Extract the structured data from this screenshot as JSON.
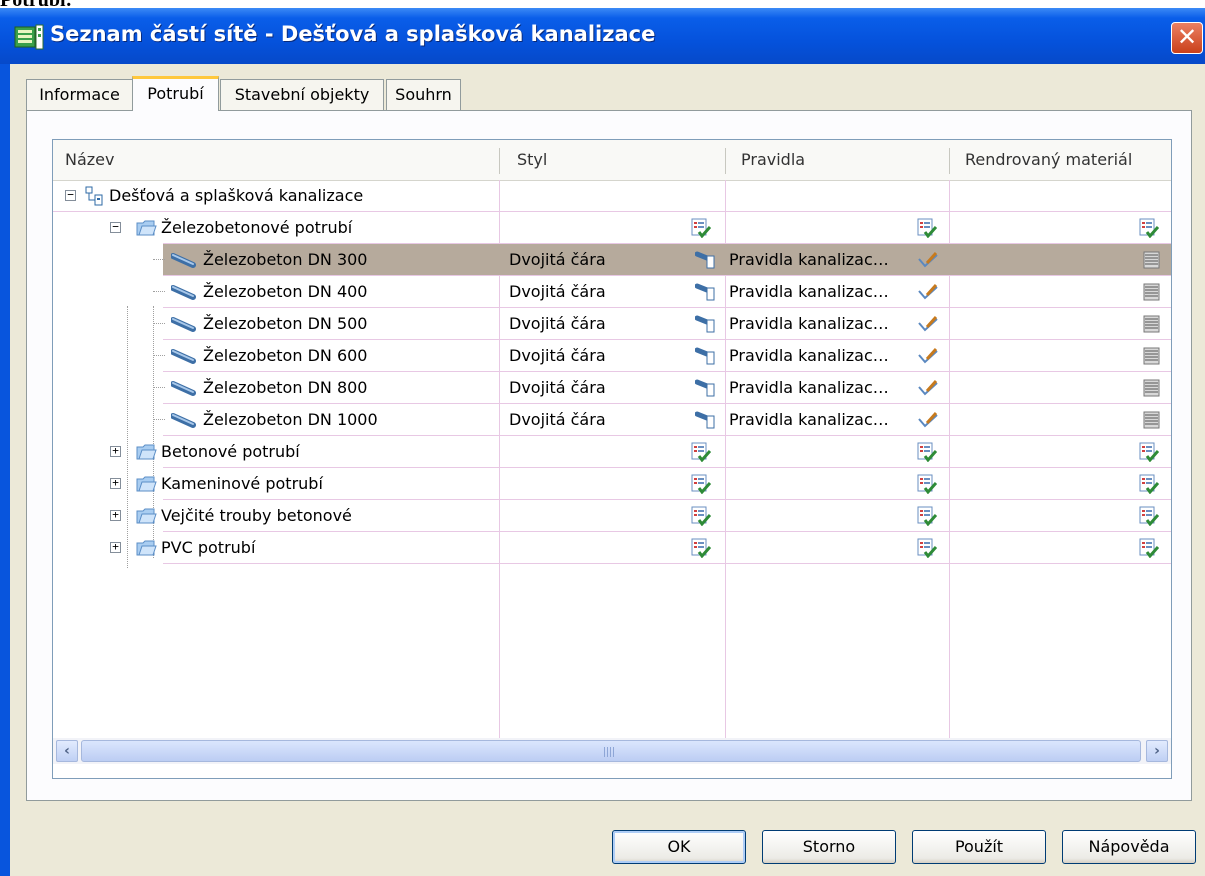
{
  "caption": "Potrubí:",
  "window": {
    "title": "Seznam částí sítě - Dešťová a splašková kanalizace",
    "close_glyph": "✕"
  },
  "tabs": [
    {
      "label": "Informace"
    },
    {
      "label": "Potrubí",
      "active": true
    },
    {
      "label": "Stavební objekty"
    },
    {
      "label": "Souhrn"
    }
  ],
  "columns": {
    "name": "Název",
    "style": "Styl",
    "rules": "Pravidla",
    "material": "Rendrovaný materiál"
  },
  "tree": {
    "root": {
      "label": "Dešťová a splašková kanalizace",
      "expander": "−"
    },
    "expanded_group": {
      "label": "Železobetonové potrubí",
      "expander": "−"
    },
    "items": [
      {
        "name": "Železobeton DN 300",
        "style": "Dvojitá čára",
        "rules": "Pravidla kanalizac…",
        "selected": true
      },
      {
        "name": "Železobeton DN 400",
        "style": "Dvojitá čára",
        "rules": "Pravidla kanalizac…"
      },
      {
        "name": "Železobeton DN 500",
        "style": "Dvojitá čára",
        "rules": "Pravidla kanalizac…"
      },
      {
        "name": "Železobeton DN 600",
        "style": "Dvojitá čára",
        "rules": "Pravidla kanalizac…"
      },
      {
        "name": "Železobeton DN 800",
        "style": "Dvojitá čára",
        "rules": "Pravidla kanalizac…"
      },
      {
        "name": "Železobeton DN 1000",
        "style": "Dvojitá čára",
        "rules": "Pravidla kanalizac…"
      }
    ],
    "collapsed_groups": [
      {
        "label": "Betonové potrubí",
        "expander": "+"
      },
      {
        "label": "Kameninové potrubí",
        "expander": "+"
      },
      {
        "label": "Vejčité trouby betonové",
        "expander": "+"
      },
      {
        "label": "PVC potrubí",
        "expander": "+"
      }
    ]
  },
  "scrollbar": {
    "left_glyph": "‹",
    "right_glyph": "›"
  },
  "buttons": {
    "ok": "OK",
    "cancel": "Storno",
    "apply": "Použít",
    "help": "Nápověda"
  },
  "colors": {
    "titlebar": "#0552dc",
    "selection": "#b6aa9c",
    "dialog": "#ece9d8"
  }
}
